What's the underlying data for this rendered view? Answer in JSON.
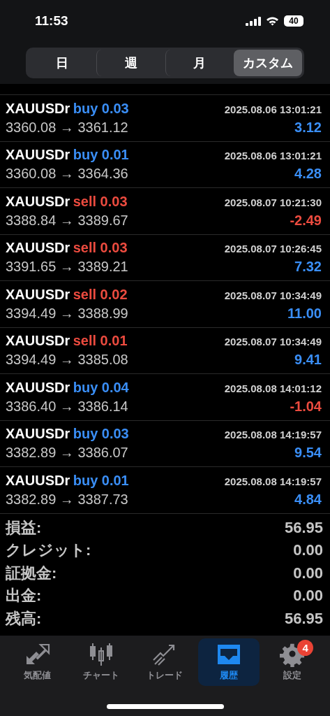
{
  "status_bar": {
    "time": "11:53",
    "battery": "40"
  },
  "period_tabs": [
    {
      "label": "日",
      "selected": false
    },
    {
      "label": "週",
      "selected": false
    },
    {
      "label": "月",
      "selected": false
    },
    {
      "label": "カスタム",
      "selected": true
    }
  ],
  "trades": [
    {
      "symbol": "XAUUSDr",
      "side": {
        "text": "buy 0.03",
        "color": "#3a8ef6"
      },
      "time": "2025.08.06 13:01:21",
      "prices": "3360.08 → 3361.12",
      "profit": {
        "text": "3.12",
        "color": "#3a8ef6"
      }
    },
    {
      "symbol": "XAUUSDr",
      "side": {
        "text": "buy 0.01",
        "color": "#3a8ef6"
      },
      "time": "2025.08.06 13:01:21",
      "prices": "3360.08 → 3364.36",
      "profit": {
        "text": "4.28",
        "color": "#3a8ef6"
      }
    },
    {
      "symbol": "XAUUSDr",
      "side": {
        "text": "sell 0.03",
        "color": "#ec4b3f"
      },
      "time": "2025.08.07 10:21:30",
      "prices": "3388.84 → 3389.67",
      "profit": {
        "text": "-2.49",
        "color": "#ec4b3f"
      }
    },
    {
      "symbol": "XAUUSDr",
      "side": {
        "text": "sell 0.03",
        "color": "#ec4b3f"
      },
      "time": "2025.08.07 10:26:45",
      "prices": "3391.65 → 3389.21",
      "profit": {
        "text": "7.32",
        "color": "#3a8ef6"
      }
    },
    {
      "symbol": "XAUUSDr",
      "side": {
        "text": "sell 0.02",
        "color": "#ec4b3f"
      },
      "time": "2025.08.07 10:34:49",
      "prices": "3394.49 → 3388.99",
      "profit": {
        "text": "11.00",
        "color": "#3a8ef6"
      }
    },
    {
      "symbol": "XAUUSDr",
      "side": {
        "text": "sell 0.01",
        "color": "#ec4b3f"
      },
      "time": "2025.08.07 10:34:49",
      "prices": "3394.49 → 3385.08",
      "profit": {
        "text": "9.41",
        "color": "#3a8ef6"
      }
    },
    {
      "symbol": "XAUUSDr",
      "side": {
        "text": "buy 0.04",
        "color": "#3a8ef6"
      },
      "time": "2025.08.08 14:01:12",
      "prices": "3386.40 → 3386.14",
      "profit": {
        "text": "-1.04",
        "color": "#ec4b3f"
      }
    },
    {
      "symbol": "XAUUSDr",
      "side": {
        "text": "buy 0.03",
        "color": "#3a8ef6"
      },
      "time": "2025.08.08 14:19:57",
      "prices": "3382.89 → 3386.07",
      "profit": {
        "text": "9.54",
        "color": "#3a8ef6"
      }
    },
    {
      "symbol": "XAUUSDr",
      "side": {
        "text": "buy 0.01",
        "color": "#3a8ef6"
      },
      "time": "2025.08.08 14:19:57",
      "prices": "3382.89 → 3387.73",
      "profit": {
        "text": "4.84",
        "color": "#3a8ef6"
      }
    }
  ],
  "summary": [
    {
      "label": "損益:",
      "value": "56.95"
    },
    {
      "label": "クレジット:",
      "value": "0.00"
    },
    {
      "label": "証拠金:",
      "value": "0.00"
    },
    {
      "label": "出金:",
      "value": "0.00"
    },
    {
      "label": "残高:",
      "value": "56.95"
    }
  ],
  "tab_bar": [
    {
      "label": "気配値",
      "selected": false
    },
    {
      "label": "チャート",
      "selected": false
    },
    {
      "label": "トレード",
      "selected": false
    },
    {
      "label": "履歴",
      "selected": true
    },
    {
      "label": "設定",
      "selected": false,
      "badge": "4"
    }
  ]
}
